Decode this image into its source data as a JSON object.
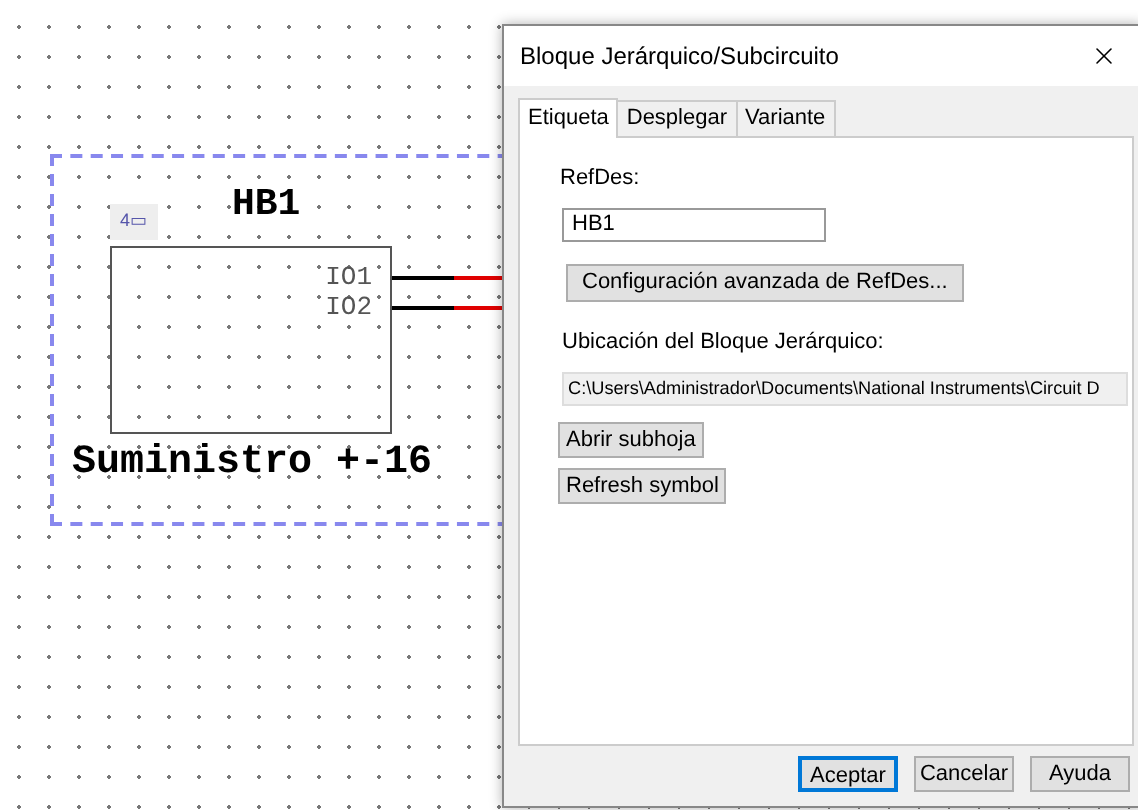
{
  "schematic": {
    "block": {
      "badge": "4▭",
      "refdes": "HB1",
      "pins": [
        "IO1",
        "IO2"
      ],
      "label": "Suministro +-16"
    }
  },
  "dialog": {
    "title": "Bloque Jerárquico/Subcircuito",
    "tabs": [
      {
        "label": "Etiqueta",
        "selected": true
      },
      {
        "label": "Desplegar",
        "selected": false
      },
      {
        "label": "Variante",
        "selected": false
      }
    ],
    "refdes_label": "RefDes:",
    "refdes_value": "HB1",
    "advanced_button": "Configuración avanzada de RefDes...",
    "location_label": "Ubicación del Bloque Jerárquico:",
    "location_value": "C:\\Users\\Administrador\\Documents\\National Instruments\\Circuit D",
    "side_buttons": [
      "Abrir subhoja",
      "Refresh symbol"
    ],
    "footer_buttons": [
      {
        "label": "Aceptar",
        "default": true
      },
      {
        "label": "Cancelar",
        "default": false
      },
      {
        "label": "Ayuda",
        "default": false
      }
    ]
  }
}
